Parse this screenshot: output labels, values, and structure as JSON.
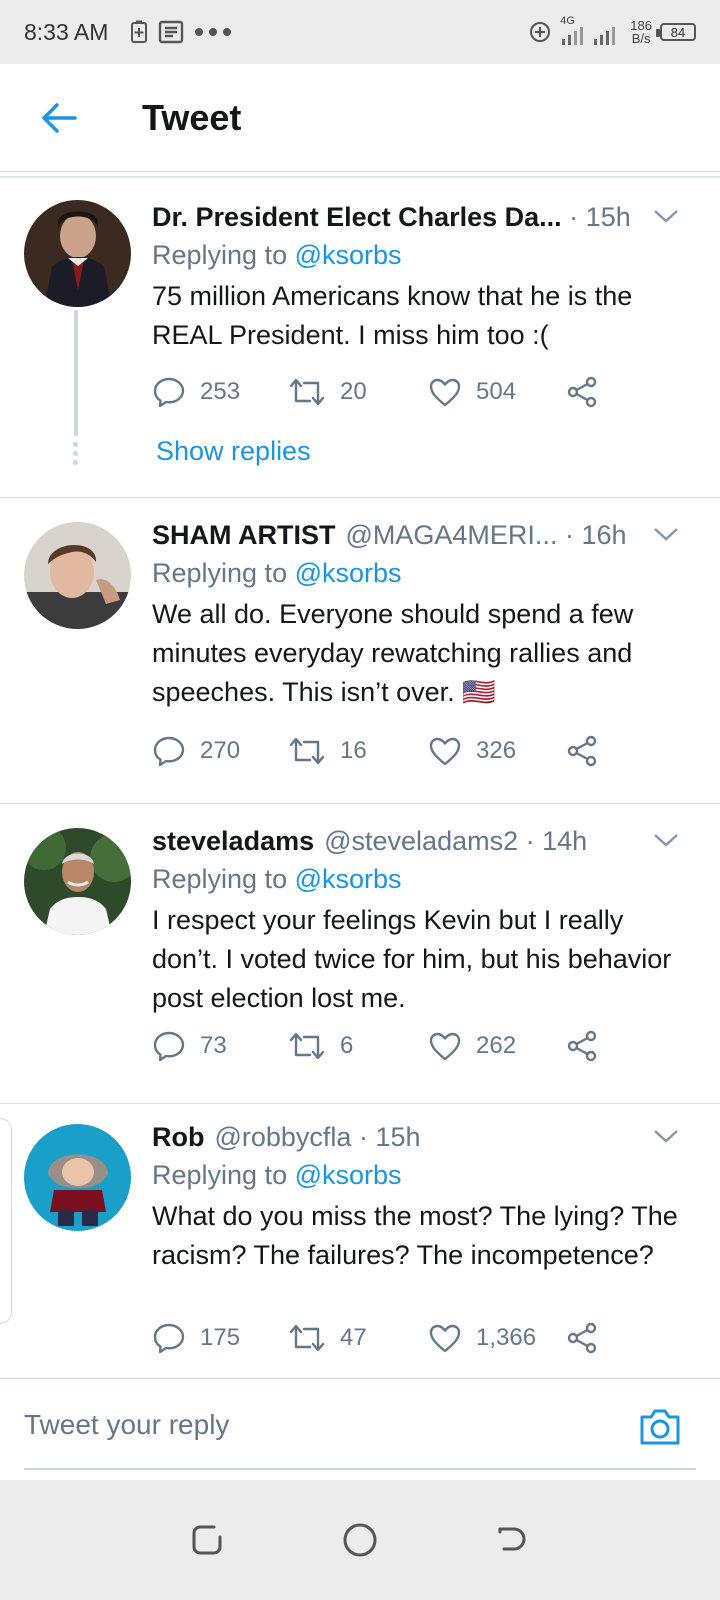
{
  "status_bar": {
    "time": "8:33 AM",
    "network": "4G",
    "speed_value": "186",
    "speed_unit": "B/s",
    "battery": "84"
  },
  "header": {
    "title": "Tweet",
    "back_icon": "arrow-left-icon"
  },
  "tweets": [
    {
      "name": "Dr. President Elect Charles Da...",
      "handle": "",
      "time": "15h",
      "replying_label": "Replying to",
      "mention": "@ksorbs",
      "text": "75 million Americans know that he is the REAL President. I miss him too :(",
      "replies": "253",
      "retweets": "20",
      "likes": "504",
      "show_replies": "Show replies"
    },
    {
      "name": "SHAM ARTIST",
      "handle": "@MAGA4MERI...",
      "time": "16h",
      "replying_label": "Replying to",
      "mention": "@ksorbs",
      "text": "We all do. Everyone should spend a few minutes everyday rewatching rallies and speeches. This isn’t over. 🇺🇸",
      "replies": "270",
      "retweets": "16",
      "likes": "326"
    },
    {
      "name": "steveladams",
      "handle": "@steveladams2",
      "time": "14h",
      "replying_label": "Replying to",
      "mention": "@ksorbs",
      "text": "I respect your feelings Kevin but I really don’t. I voted twice for him, but his behavior post election lost me.",
      "replies": "73",
      "retweets": "6",
      "likes": "262"
    },
    {
      "name": "Rob",
      "handle": "@robbycfla",
      "time": "15h",
      "replying_label": "Replying to",
      "mention": "@ksorbs",
      "text": "What do you miss the most? The lying? The racism? The failures? The incompetence?",
      "replies": "175",
      "retweets": "47",
      "likes": "1,366"
    }
  ],
  "reply_bar": {
    "placeholder": "Tweet your reply"
  },
  "colors": {
    "accent": "#1b95e0",
    "muted": "#657786",
    "text": "#14171a"
  }
}
